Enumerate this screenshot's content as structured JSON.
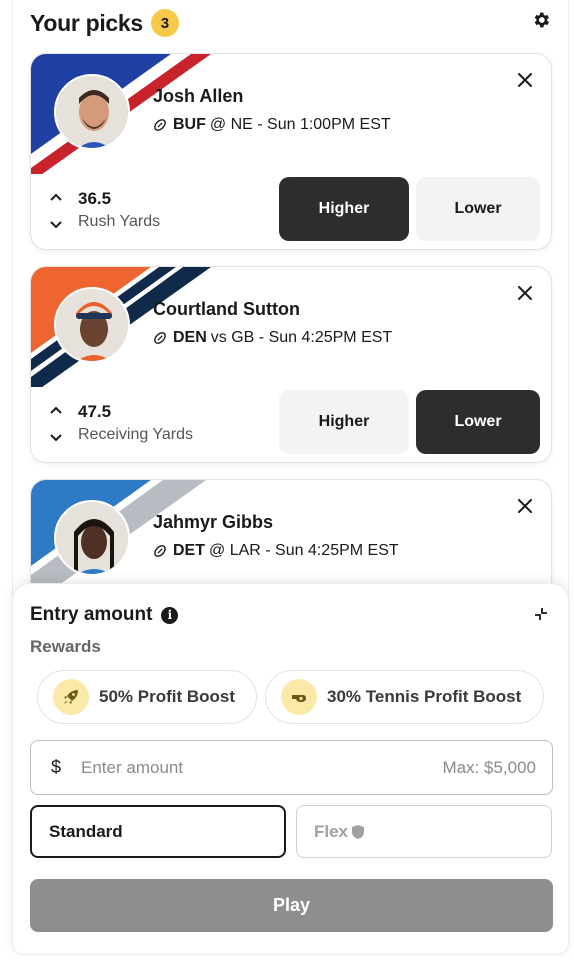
{
  "header": {
    "title": "Your picks",
    "count": "3"
  },
  "picks": [
    {
      "name": "Josh Allen",
      "team": "BUF",
      "matchup_rest": "@ NE - Sun 1:00PM EST",
      "line": "36.5",
      "stat": "Rush Yards",
      "higher_label": "Higher",
      "lower_label": "Lower",
      "selected": "higher",
      "colors": {
        "primary": "#1f3fa3",
        "secondary": "#c8232c"
      }
    },
    {
      "name": "Courtland Sutton",
      "team": "DEN",
      "matchup_rest": "vs GB - Sun 4:25PM EST",
      "line": "47.5",
      "stat": "Receiving Yards",
      "higher_label": "Higher",
      "lower_label": "Lower",
      "selected": "lower",
      "colors": {
        "primary": "#ef6530",
        "secondary": "#0f2a4a"
      }
    },
    {
      "name": "Jahmyr Gibbs",
      "team": "DET",
      "matchup_rest": "@ LAR - Sun 4:25PM EST",
      "colors": {
        "primary": "#2f7ac4",
        "secondary": "#b6bcc2"
      }
    }
  ],
  "entry": {
    "title": "Entry amount",
    "rewards_label": "Rewards",
    "rewards": [
      {
        "label": "50% Profit Boost",
        "icon": "rocket-icon"
      },
      {
        "label": "30% Tennis Profit Boost",
        "icon": "whistle-icon"
      }
    ],
    "amount": {
      "currency": "$",
      "placeholder": "Enter amount",
      "max": "Max: $5,000"
    },
    "modes": {
      "standard": "Standard",
      "flex": "Flex"
    },
    "play_label": "Play"
  },
  "colors": {
    "badge": "#f7c948",
    "dark_button": "#2d2d2d",
    "play_disabled": "#8e8e8e",
    "reward_icon_bg": "#fbe9a9"
  }
}
